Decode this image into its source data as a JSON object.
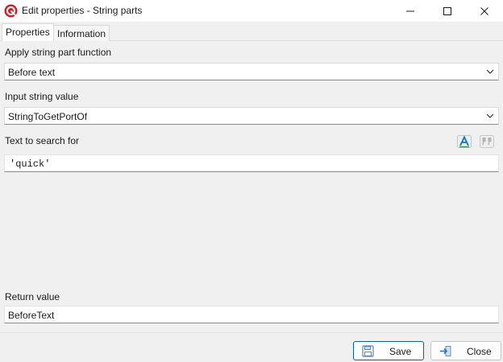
{
  "window": {
    "title": "Edit properties - String parts"
  },
  "tabs": [
    {
      "label": "Properties",
      "active": true
    },
    {
      "label": "Information",
      "active": false
    }
  ],
  "form": {
    "function_label": "Apply string part function",
    "function_value": "Before text",
    "input_label": "Input string value",
    "input_value": "StringToGetPortOf",
    "search_label": "Text to search for",
    "search_value": "'quick'",
    "return_label": "Return value",
    "return_value": "BeforeText"
  },
  "buttons": {
    "save_label": "Save",
    "close_label": "Close"
  },
  "icons": {
    "app": "app-logo-icon",
    "minimize": "minimize-icon",
    "maximize": "maximize-icon",
    "close": "close-icon",
    "expression": "expression-editor-icon",
    "quote": "quote-icon",
    "save": "floppy-disk-icon",
    "exit": "exit-arrow-icon"
  },
  "colors": {
    "accent": "#0063b1",
    "app_icon": "#c0262d"
  }
}
